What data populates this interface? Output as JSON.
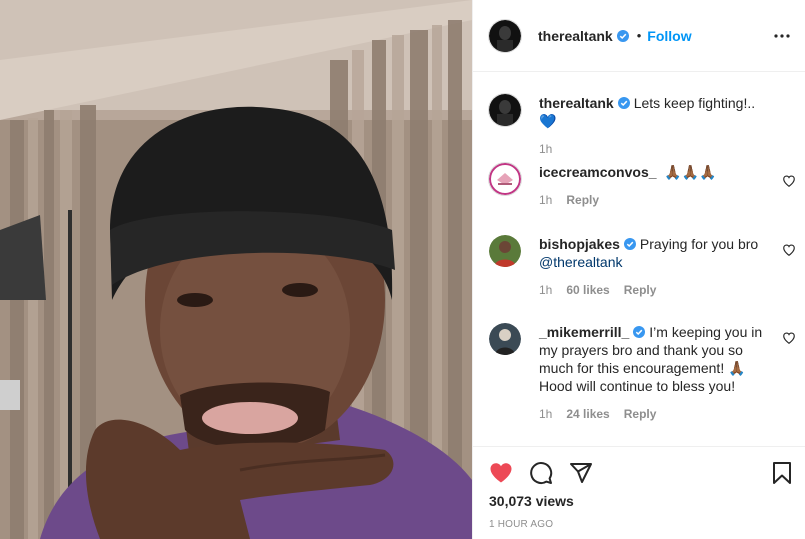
{
  "post": {
    "author": "therealtank",
    "follow_label": "Follow",
    "separator": "•",
    "caption": {
      "username": "therealtank",
      "text": "Lets keep fighting!..💙",
      "time": "1h"
    },
    "comments": [
      {
        "username": "icecreamconvos_",
        "verified": false,
        "text": "🙏🏾🙏🏾🙏🏾",
        "mention": "",
        "time": "1h",
        "likes": "",
        "reply": "Reply"
      },
      {
        "username": "bishopjakes",
        "verified": true,
        "text": "Praying for you bro",
        "mention": "@therealtank",
        "time": "1h",
        "likes": "60 likes",
        "reply": "Reply"
      },
      {
        "username": "_mikemerrill_",
        "verified": true,
        "text": "I’m keeping you in my prayers bro and thank you so much for this encouragement! 🙏🏾 Hood will continue to bless you!",
        "mention": "",
        "time": "1h",
        "likes": "24 likes",
        "reply": "Reply"
      }
    ],
    "views": "30,073 views",
    "posted_ago": "1 HOUR AGO"
  },
  "colors": {
    "like_red": "#ed4956",
    "link_blue": "#0095f6",
    "verified_blue": "#3897f0",
    "muted": "#8e8e8e"
  },
  "icons": [
    "verified-badge-icon",
    "more-options-icon",
    "heart-icon",
    "comment-icon",
    "share-icon",
    "bookmark-icon"
  ]
}
